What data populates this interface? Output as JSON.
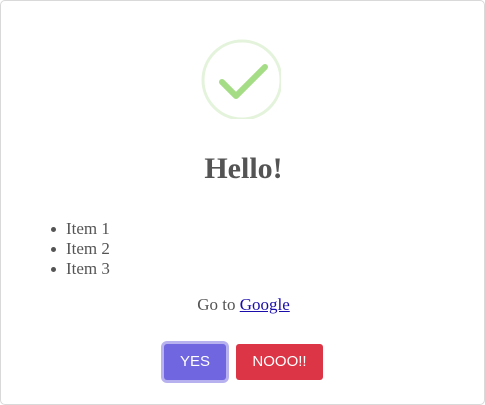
{
  "dialog": {
    "icon": "success-check-icon",
    "title": "Hello!",
    "items": [
      "Item 1",
      "Item 2",
      "Item 3"
    ],
    "goto_prefix": "Go to",
    "goto_link": "Google",
    "confirm_label": "YES",
    "deny_label": "NOOO!!"
  },
  "colors": {
    "success_ring": "#e4f3db",
    "success_check": "#a5dc86",
    "confirm_button": "#7066e0",
    "deny_button": "#dc3545",
    "text": "#545454"
  }
}
